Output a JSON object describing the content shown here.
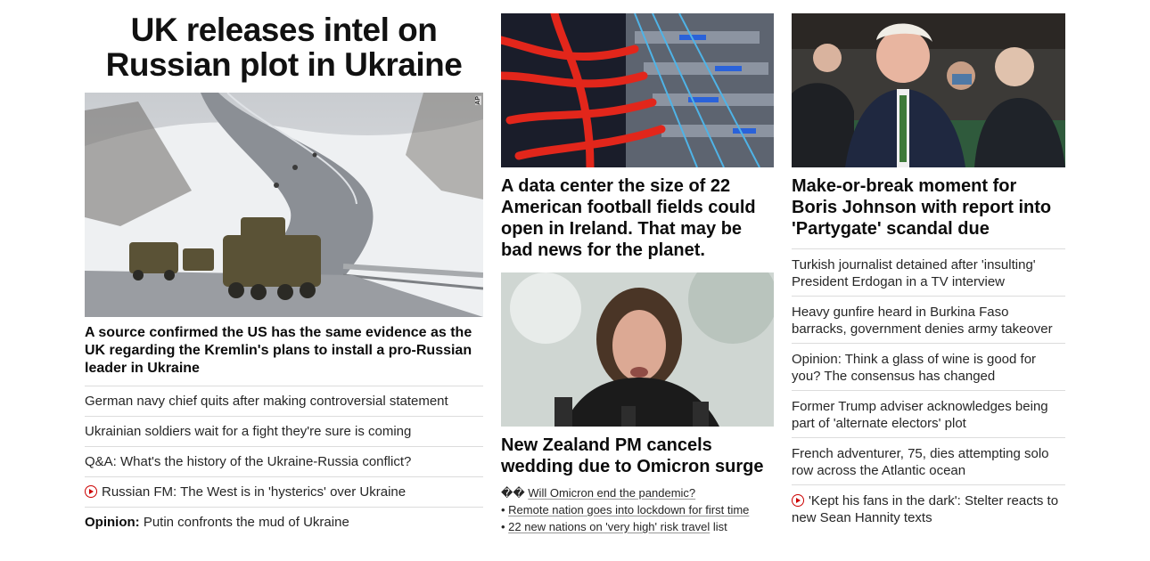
{
  "col1": {
    "title": "UK releases intel on Russian plot in Ukraine",
    "image_credit": "AP",
    "caption": "A source confirmed the US has the same evidence as the UK regarding the Kremlin's plans to install a pro-Russian leader in Ukraine",
    "links": [
      {
        "text": "German navy chief quits after making controversial statement",
        "video": false
      },
      {
        "text": "Ukrainian soldiers wait for a fight they're sure is coming",
        "video": false
      },
      {
        "text": "Q&A: What's the history of the Ukraine-Russia conflict?",
        "video": false
      },
      {
        "text": "Russian FM: The West is in 'hysterics' over Ukraine",
        "video": true
      }
    ],
    "opinion": {
      "label": "Opinion:",
      "text": "Putin confronts the mud of Ukraine"
    }
  },
  "col2": {
    "story1_title": "A data center the size of 22 American football fields could open in Ireland. That may be bad news for the planet.",
    "story2_title": "New Zealand PM cancels wedding due to Omicron surge",
    "bullets": [
      {
        "prefix": "�� ",
        "link": "Will Omicron end the pandemic?",
        "suffix": ""
      },
      {
        "prefix": "• ",
        "link": "Remote nation goes into lockdown for first time",
        "suffix": ""
      },
      {
        "prefix": "• ",
        "link": "22 new nations on 'very high' risk travel",
        "suffix": " list"
      }
    ]
  },
  "col3": {
    "title": "Make-or-break moment for Boris Johnson with report into 'Partygate' scandal due",
    "links": [
      {
        "text": "Turkish journalist detained after 'insulting' President Erdogan in a TV interview",
        "video": false
      },
      {
        "text": "Heavy gunfire heard in Burkina Faso barracks, government denies army takeover",
        "video": false
      },
      {
        "text": "Opinion: Think a glass of wine is good for you? The consensus has changed",
        "video": false
      },
      {
        "text": "Former Trump adviser acknowledges being part of 'alternate electors' plot",
        "video": false
      },
      {
        "text": "French adventurer, 75, dies attempting solo row across the Atlantic ocean",
        "video": false
      },
      {
        "text": "'Kept his fans in the dark': Stelter reacts to new Sean Hannity texts",
        "video": true
      }
    ]
  },
  "colors": {
    "accent_red": "#cc0000",
    "divider": "#dcdcdc",
    "text": "#0c0c0c"
  }
}
